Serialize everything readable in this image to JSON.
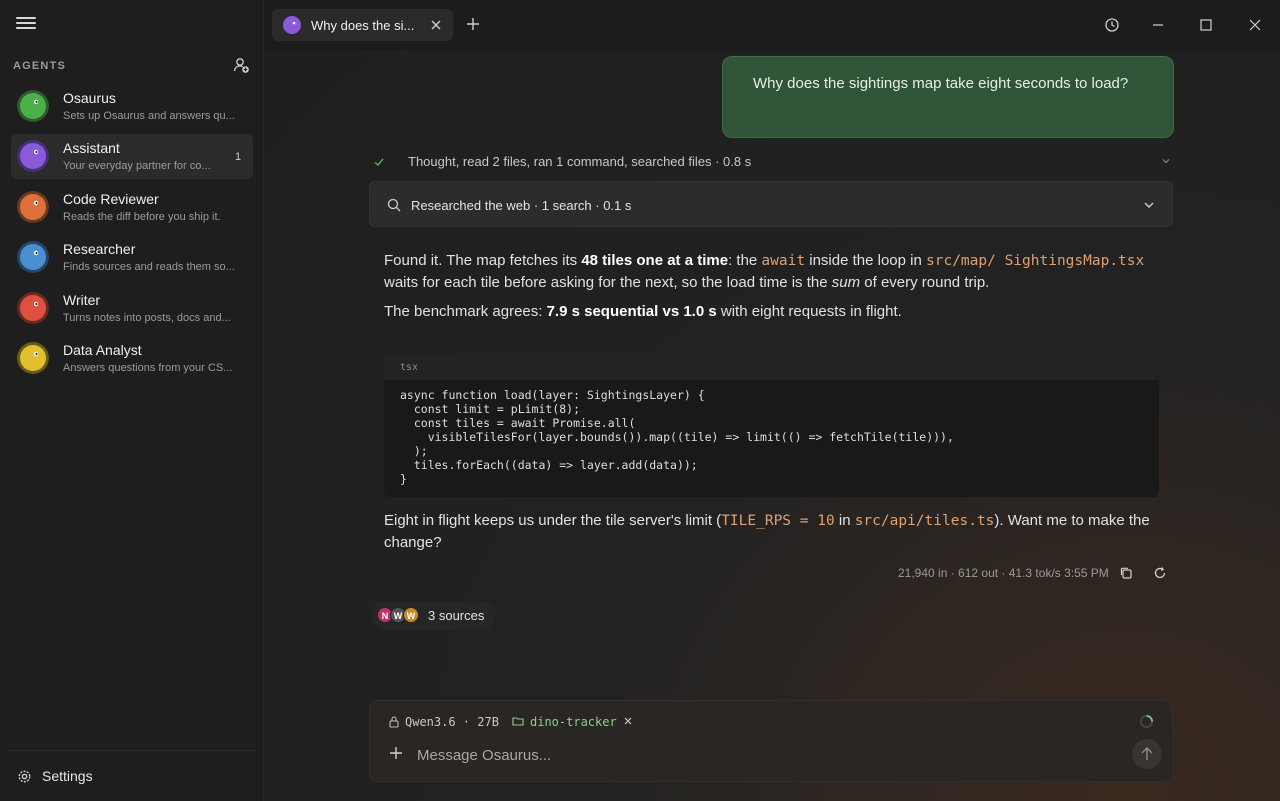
{
  "sidebar": {
    "section_label": "AGENTS",
    "agents": [
      {
        "name": "Osaurus",
        "desc": "Sets up Osaurus and answers qu...",
        "color": "#49b04a"
      },
      {
        "name": "Assistant",
        "desc": "Your everyday partner for co...",
        "color": "#8a5ad8",
        "badge": "1"
      },
      {
        "name": "Code Reviewer",
        "desc": "Reads the diff before you ship it.",
        "color": "#e0703a"
      },
      {
        "name": "Researcher",
        "desc": "Finds sources and reads them so...",
        "color": "#4a90d0"
      },
      {
        "name": "Writer",
        "desc": "Turns notes into posts, docs and...",
        "color": "#e05040"
      },
      {
        "name": "Data Analyst",
        "desc": "Answers questions from your CS...",
        "color": "#e0c030"
      }
    ],
    "settings_label": "Settings"
  },
  "tab": {
    "title": "Why does the si..."
  },
  "chat": {
    "user_message": "Why does the sightings map take eight seconds to load?",
    "thought_summary": "Thought, read 2 files, ran 1 command, searched files · 0.8 s",
    "research_summary": "Researched the web · 1 search · 0.1 s",
    "answer": {
      "p1_a": "Found it. The map fetches its ",
      "p1_b": "48 tiles one at a time",
      "p1_c": ": the ",
      "p1_code1": "await",
      "p1_d": " inside the loop in ",
      "p1_code2": "src/map/ SightingsMap.tsx",
      "p1_e": " waits for each tile before asking for the next, so the load time is the ",
      "p1_em": "sum",
      "p1_f": " of every round trip.",
      "p2_a": "The benchmark agrees: ",
      "p2_b": "7.9 s sequential vs 1.0 s",
      "p2_c": " with eight requests in flight.",
      "code_lang": "tsx",
      "code": "async function load(layer: SightingsLayer) {\n  const limit = pLimit(8);\n  const tiles = await Promise.all(\n    visibleTilesFor(layer.bounds()).map((tile) => limit(() => fetchTile(tile))),\n  );\n  tiles.forEach((data) => layer.add(data));\n}",
      "p3_a": "Eight in flight keeps us under the tile server's limit (",
      "p3_code1": "TILE_RPS = 10",
      "p3_b": " in ",
      "p3_code2": "src/api/tiles.ts",
      "p3_c": "). Want me to make the change?"
    },
    "meta": "21,940 in · 612 out · 41.3 tok/s  3:55 PM",
    "sources_label": "3 sources",
    "source_icons": [
      {
        "letter": "N",
        "color": "#c0306a"
      },
      {
        "letter": "W",
        "color": "#555"
      },
      {
        "letter": "W",
        "color": "#c98a2a"
      }
    ]
  },
  "composer": {
    "model": "Qwen3.6 · 27B",
    "project": "dino-tracker",
    "placeholder": "Message Osaurus..."
  }
}
